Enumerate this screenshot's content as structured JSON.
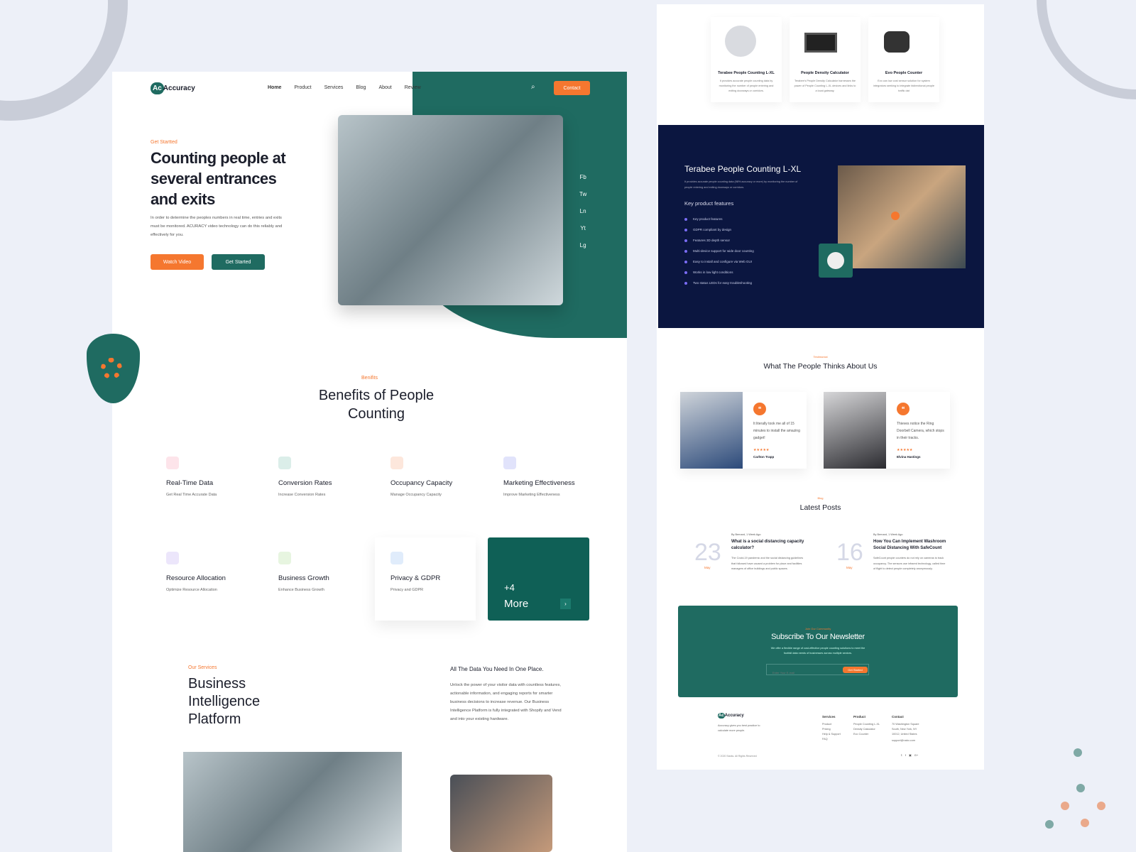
{
  "brand": {
    "logo": "Accuracy",
    "accent": "#f5772f",
    "primary": "#1f6b61",
    "dark": "#0b1640"
  },
  "nav": {
    "items": [
      "Home",
      "Product",
      "Services",
      "Blog",
      "About",
      "Review"
    ],
    "contact": "Contact"
  },
  "hero": {
    "eyebrow": "Get Startted",
    "title": "Counting people at several entrances and exits",
    "text": "In order to determine the peoples numbers in real time, entries and exits must be monitored. ACURACY video technology can do this reliably and effectively for you.",
    "watch": "Watch Video",
    "start": "Get Started",
    "social": [
      "Fb",
      "Tw",
      "Ln",
      "Yt",
      "Lg"
    ]
  },
  "benefits": {
    "eyebrow": "Benifits",
    "title": "Benefits of People Counting",
    "items": [
      {
        "title": "Real-Time Data",
        "desc": "Get Real Time Accurate Data",
        "color": "#fde4ea"
      },
      {
        "title": "Conversion Rates",
        "desc": "Increase Conversion Rates",
        "color": "#dbeee9"
      },
      {
        "title": "Occupancy Capacity",
        "desc": "Manage Occupancy Capacity",
        "color": "#fde7dc"
      },
      {
        "title": "Marketing Effectiveness",
        "desc": "Improve Marketing Effectiveness",
        "color": "#e1e3fb"
      },
      {
        "title": "Resource Allocation",
        "desc": "Optimize Resource Allocation",
        "color": "#ece6fb"
      },
      {
        "title": "Business Growth",
        "desc": "Enhance Business Growth",
        "color": "#e7f5e0"
      },
      {
        "title": "Privacy & GDPR",
        "desc": "Privacy and GDPR",
        "color": "#e0ecfb"
      }
    ],
    "more_count": "+4",
    "more": "More"
  },
  "services": {
    "eyebrow": "Our Services",
    "title": "Business Intelligence Platform",
    "subtitle": "All The Data You Need In One Place.",
    "text": "Unlock the power of your visitor data with countless features, actionable information, and engaging reports for smarter business decisions to increase revenue. Our Business Intelligence Platform is fully integrated with Shopify and Vend and into your existing hardware."
  },
  "products": [
    {
      "name": "Terabee People Counting L-XL",
      "desc": "It provides accurate people counting data by monitoring the number of people entering and exiting doorways or corridors."
    },
    {
      "name": "People Density Calculator",
      "desc": "Terabee's People Density Calculator harnesses the power of People Counting L-XL devices and links to a local gateway."
    },
    {
      "name": "Evo People Counter",
      "desc": "Evo can low cost sensor solution for system integrators seeking to integrate bidirectional people traffic dat"
    }
  ],
  "feature": {
    "title": "Terabee People Counting L-XL",
    "text": "It provides accurate people counting data (98% accuracy or more) by monitoring the number of people entering and exiting doorways or corridors.",
    "subtitle": "Key product features",
    "list": [
      "Key product features",
      "GDPR compliant by design",
      "Features 3D depth sensor",
      "Multi-device support for wide door counting",
      "Easy to install and configure via Web GUI",
      "Works in low light conditions",
      "Two status LEDs for easy troubleshooting"
    ]
  },
  "testimonials": {
    "eyebrow": "Testimonial",
    "title": "What The People Thinks About Us",
    "items": [
      {
        "quote": "It literally took me all of 15 minutes to install the amazing gadget!",
        "stars": "★★★★★",
        "name": "Carlton Trapp"
      },
      {
        "quote": "Thieves notice the Ring Doorbell Camera, which stops in their tracks.",
        "stars": "★★★★★",
        "name": "Elvina Hastings"
      }
    ]
  },
  "posts": {
    "eyebrow": "Blog",
    "title": "Latest Posts",
    "items": [
      {
        "day": "23",
        "month": "May",
        "by": "By Bernard, 1 Week Ago",
        "title": "What is a social distancing capacity calculator?",
        "text": "The Covid-19 pandemic and the social distancing guidelines that followed have caused a problem for place and facilities managers of office buildings and public spaces."
      },
      {
        "day": "16",
        "month": "May",
        "by": "By Bernard, 1 Week Ago",
        "title": "How You Can Implement Washroom Social Distancing With SafeCount",
        "text": "SafeCount people counters do not rely on cameras to track occupancy. The sensors use infrared technology, called time of flight to detect people completely anonymously."
      }
    ]
  },
  "newsletter": {
    "eyebrow": "Join Our Community",
    "title": "Subscribe To Our Newsletter",
    "text": "We offer a flexible range of cost-effective people counting solutions to meet the footfall data needs of businesses across multiple sectors.",
    "placeholder": "Enter Your E-mail",
    "button": "Get Started"
  },
  "footer": {
    "about": "Accuracy gives you best practice to calculate more people.",
    "columns": [
      {
        "title": "Services",
        "items": [
          "Product",
          "Pricing",
          "Help & Support",
          "FAQ"
        ]
      },
      {
        "title": "Product",
        "items": [
          "People Counting L-XL",
          "Density Calculator",
          "Evo Counter"
        ]
      },
      {
        "title": "Contact",
        "items": [
          "70 Washington Square South, New York, NY 10012, United States",
          "support@nako.com"
        ]
      }
    ],
    "copyright": "© 2020 Starks. All Rights Reserved",
    "social": [
      "𝕥",
      "f",
      "▣",
      "G+"
    ]
  }
}
